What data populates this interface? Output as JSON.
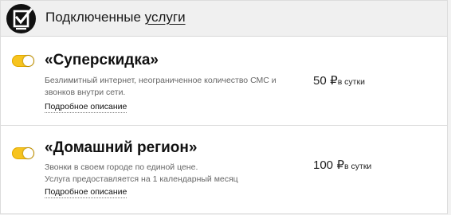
{
  "header": {
    "title_plain": "Подключенные ",
    "title_underlined": "услуги",
    "logo_icon": "checkbox-badge-icon"
  },
  "services": [
    {
      "title": "«Суперскидка»",
      "enabled": true,
      "description_line1": "Безлимитный интернет, неограниченное количество СМС и",
      "description_line2": "звонков внутри сети.",
      "details_link": "Подробное описание",
      "price_amount": "50",
      "price_currency": "₽",
      "price_period": "в сутки"
    },
    {
      "title": "«Домашний регион»",
      "enabled": true,
      "description_line1": "Звонки в своем городе по единой цене.",
      "description_line2": "Услуга предоставляется на 1 календарный месяц",
      "details_link": "Подробное описание",
      "price_amount": "100",
      "price_currency": "₽",
      "price_period": "в сутки"
    }
  ],
  "colors": {
    "toggle_on": "#f7c41f",
    "logo_bg": "#111111",
    "header_bg": "#f0f0f0"
  }
}
